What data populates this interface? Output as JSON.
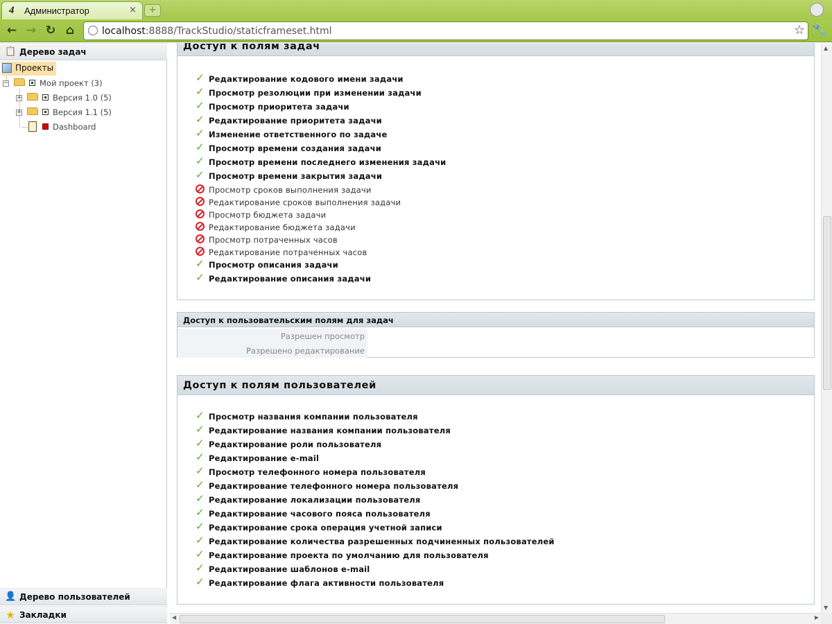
{
  "browser": {
    "tab_title": "Администратор",
    "tab_close": "×",
    "new_tab": "+",
    "url_host": "localhost",
    "url_rest": ":8888/TrackStudio/staticframeset.html"
  },
  "left": {
    "task_tree_title": "Дерево задач",
    "root_label": "Проекты",
    "nodes": [
      {
        "label": "Мой проект (3)"
      },
      {
        "label": "Версия 1.0 (5)"
      },
      {
        "label": "Версия 1.1 (5)"
      },
      {
        "label": "Dashboard"
      }
    ],
    "user_tree_title": "Дерево пользователей",
    "bookmarks_title": "Закладки"
  },
  "task_fields": {
    "title": "Доступ к полям задач",
    "items": [
      {
        "label": "Редактирование кодового имени задачи",
        "allowed": true
      },
      {
        "label": "Просмотр резолюции при изменении задачи",
        "allowed": true
      },
      {
        "label": "Просмотр приоритета задачи",
        "allowed": true
      },
      {
        "label": "Редактирование приоритета задачи",
        "allowed": true
      },
      {
        "label": "Изменение ответственного по задаче",
        "allowed": true
      },
      {
        "label": "Просмотр времени создания задачи",
        "allowed": true
      },
      {
        "label": "Просмотр времени последнего изменения задачи",
        "allowed": true
      },
      {
        "label": "Просмотр времени закрытия задачи",
        "allowed": true
      },
      {
        "label": "Просмотр сроков выполнения задачи",
        "allowed": false
      },
      {
        "label": "Редактирование сроков выполнения задачи",
        "allowed": false
      },
      {
        "label": "Просмотр бюджета задачи",
        "allowed": false
      },
      {
        "label": "Редактирование бюджета задачи",
        "allowed": false
      },
      {
        "label": "Просмотр потраченных часов",
        "allowed": false
      },
      {
        "label": "Редактирование потраченных часов",
        "allowed": false
      },
      {
        "label": "Просмотр описания задачи",
        "allowed": true
      },
      {
        "label": "Редактирование описания задачи",
        "allowed": true
      }
    ]
  },
  "custom_fields": {
    "title": "Доступ к пользовательским полям для задач",
    "view_label": "Разрешен просмотр",
    "edit_label": "Разрешено редактирование"
  },
  "user_fields": {
    "title": "Доступ к полям пользователей",
    "items": [
      {
        "label": "Просмотр названия компании пользователя",
        "allowed": true
      },
      {
        "label": "Редактирование названия компании пользователя",
        "allowed": true
      },
      {
        "label": "Редактирование роли пользователя",
        "allowed": true
      },
      {
        "label": "Редактирование e-mail",
        "allowed": true
      },
      {
        "label": "Просмотр телефонного номера пользователя",
        "allowed": true
      },
      {
        "label": "Редактирование телефонного номера пользователя",
        "allowed": true
      },
      {
        "label": "Редактирование локализации пользователя",
        "allowed": true
      },
      {
        "label": "Редактирование часового пояса пользователя",
        "allowed": true
      },
      {
        "label": "Редактирование срока операция учетной записи",
        "allowed": true
      },
      {
        "label": "Редактирование количества разрешенных подчиненных пользователей",
        "allowed": true
      },
      {
        "label": "Редактирование проекта по умолчанию для пользователя",
        "allowed": true
      },
      {
        "label": "Редактирование шаблонов e-mail",
        "allowed": true
      },
      {
        "label": "Редактирование флага активности пользователя",
        "allowed": true
      }
    ]
  },
  "colors": {
    "allowed": "#5aac2e",
    "denied": "#d8232a",
    "browser_accent": "#a5c84c"
  }
}
